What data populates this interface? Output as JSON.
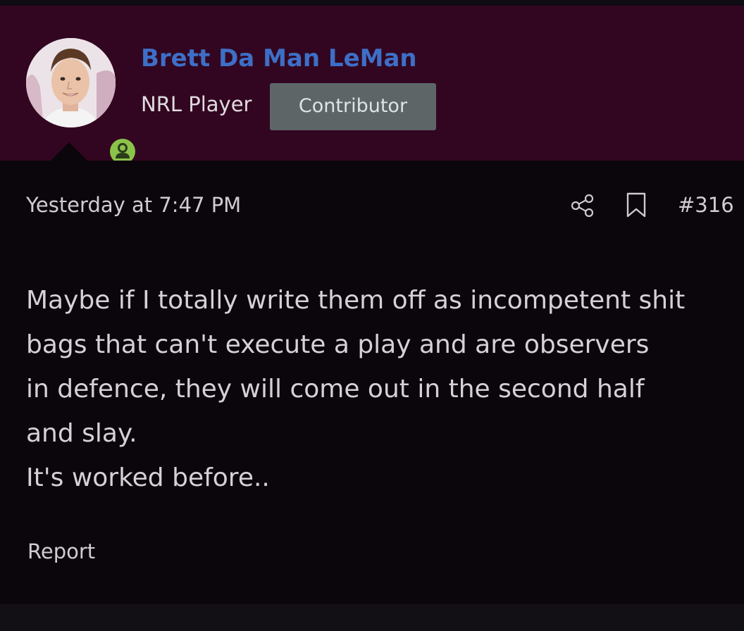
{
  "author": {
    "name": "Brett Da Man LeMan",
    "title": "NRL Player",
    "badge": "Contributor",
    "avatar_icon": "user-avatar-photo",
    "status": "online",
    "status_color": "#8bc34a"
  },
  "post": {
    "timestamp": "Yesterday at 7:47 PM",
    "number": "#316",
    "share_icon": "share-icon",
    "bookmark_icon": "bookmark-icon",
    "message_lines": [
      "Maybe if I totally write them off as incompetent shit",
      "bags that can't execute a play and are observers",
      "in defence, they will come out in the second half",
      "and slay.",
      "It's worked before.."
    ],
    "report_label": "Report"
  },
  "colors": {
    "header_bg": "#320620",
    "page_bg": "#0a060b",
    "username": "#3d6fc7",
    "badge_bg": "#5d6567"
  }
}
